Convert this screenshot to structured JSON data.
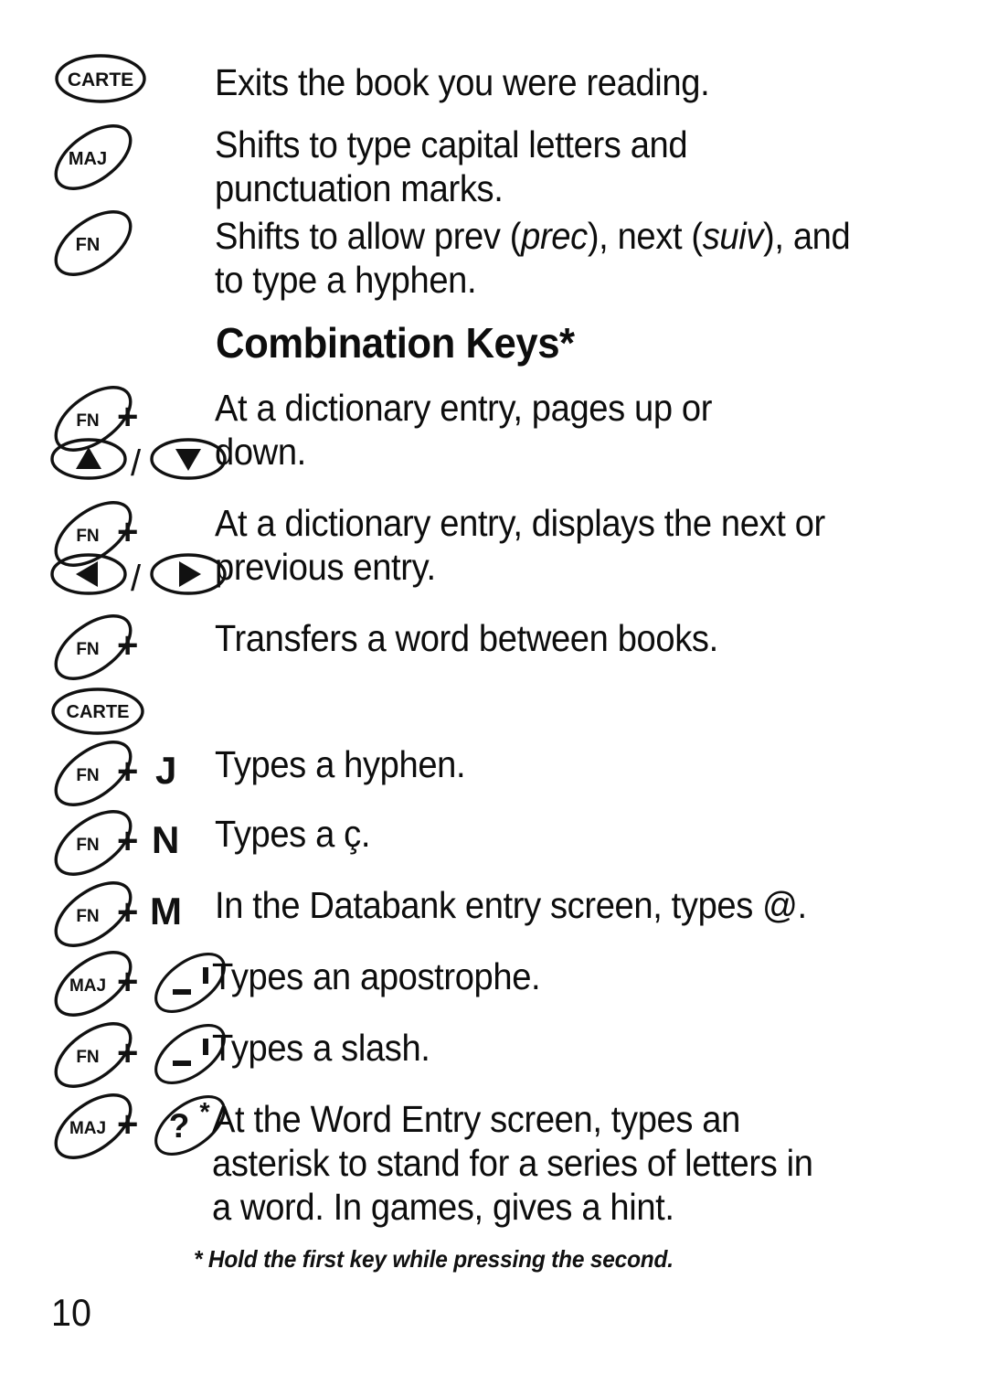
{
  "document": {
    "page_number": "10",
    "footnote": "* Hold the first key while pressing the second.",
    "section_heading": "Combination Keys*"
  },
  "single_keys": [
    {
      "key": "CARTE",
      "key_shape": "ellipse-horizontal",
      "description": "Exits the book you were reading."
    },
    {
      "key": "MAJ",
      "key_shape": "ellipse-tilted",
      "description": "Shifts to type capital letters and punctuation marks."
    },
    {
      "key": "FN",
      "key_shape": "ellipse-tilted",
      "description_pre": "Shifts to allow prev (",
      "description_ital1": "prec",
      "description_mid": "), next (",
      "description_ital2": "suiv",
      "description_post": "), and to type a hyphen."
    }
  ],
  "combination_keys": [
    {
      "first_key": "FN",
      "plus": "+",
      "second_key_a": "up-arrow",
      "separator": "/",
      "second_key_b": "down-arrow",
      "description": "At a dictionary entry, pages up or down."
    },
    {
      "first_key": "FN",
      "plus": "+",
      "second_key_a": "left-arrow",
      "separator": "/",
      "second_key_b": "right-arrow",
      "description": "At a dictionary entry, displays the next or previous entry."
    },
    {
      "first_key": "FN",
      "plus": "+",
      "second_key": "CARTE",
      "description": "Transfers a word between books."
    },
    {
      "first_key": "FN",
      "plus": "+",
      "second_key": "J",
      "description": "Types a hyphen."
    },
    {
      "first_key": "FN",
      "plus": "+",
      "second_key": "N",
      "description": "Types a ç."
    },
    {
      "first_key": "FN",
      "plus": "+",
      "second_key": "M",
      "description": "In the Databank entry screen, types @."
    },
    {
      "first_key": "MAJ",
      "plus": "+",
      "second_key": "_ '",
      "second_key_glyph_primary": "_",
      "second_key_glyph_secondary": "'",
      "description": "Types an apostrophe."
    },
    {
      "first_key": "FN",
      "plus": "+",
      "second_key": "_ '",
      "second_key_glyph_primary": "_",
      "second_key_glyph_secondary": "'",
      "description": "Types a slash."
    },
    {
      "first_key": "MAJ",
      "plus": "+",
      "second_key": "? *",
      "second_key_glyph_primary": "?",
      "second_key_glyph_secondary": "*",
      "description": "At the Word Entry screen, types an asterisk to stand for a series of letters in a word. In games, gives a hint."
    }
  ],
  "colors": {
    "ink": "#0d0d0d",
    "paper": "#ffffff"
  }
}
